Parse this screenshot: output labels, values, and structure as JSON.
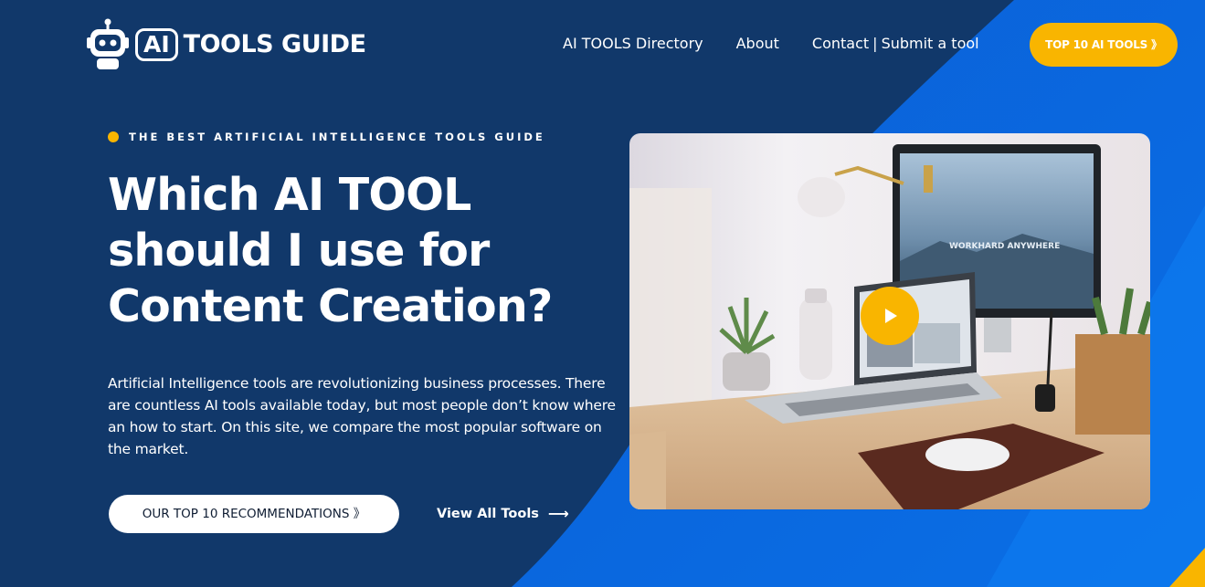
{
  "brand": {
    "ai_badge": "AI",
    "name": "TOOLS GUIDE"
  },
  "nav": {
    "directory": "AI TOOLS Directory",
    "about": "About",
    "contact": "Contact",
    "separator": "|",
    "submit": "Submit a tool"
  },
  "cta_top": "TOP 10 AI TOOLS 》",
  "hero": {
    "eyebrow": "THE BEST ARTIFICIAL INTELLIGENCE TOOLS GUIDE",
    "headline_line1": "Which AI TOOL",
    "headline_line2": "should I use for",
    "headline_line3": "Content Creation?",
    "intro": "Artificial Intelligence tools are revolutionizing business processes. There are countless AI tools available today, but most people don’t know where an how to start. On this site, we compare the most popular software on the market.",
    "primary_button": "OUR TOP 10 RECOMMENDATIONS 》",
    "secondary_link": "View All Tools",
    "secondary_arrow": "⟶"
  },
  "media": {
    "monitor_text": "WORKHARD ANYWHERE",
    "play_icon": "play-icon"
  },
  "colors": {
    "background": "#11386a",
    "accent_blue": "#0b6fe0",
    "accent_yellow": "#f9b500"
  }
}
